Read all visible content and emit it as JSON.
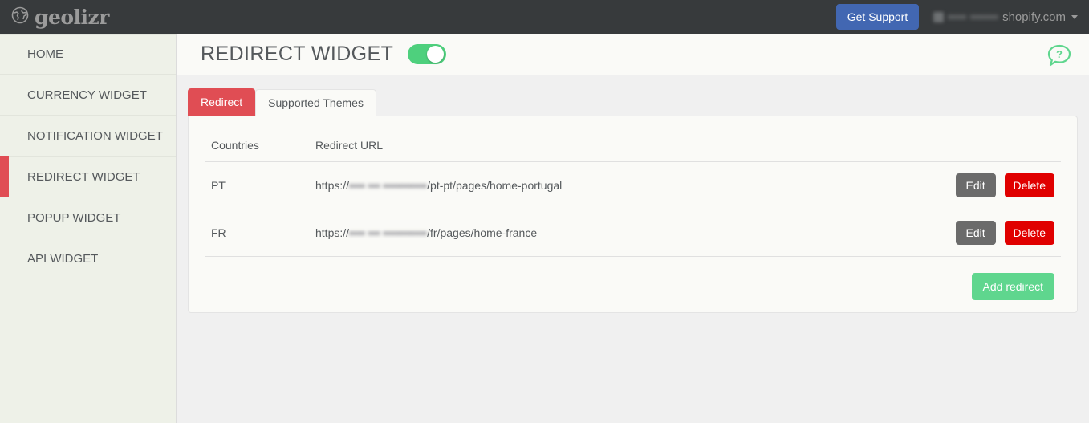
{
  "navbar": {
    "brand_name": "geolizr",
    "brand_icon": "globe-icon",
    "get_support_label": "Get Support",
    "account_redacted_text": "▪▪▪▪ ▪▪▪▪▪▪",
    "account_domain": "shopify.com",
    "caret_icon": "chevron-down-icon"
  },
  "sidebar": {
    "items": [
      {
        "label": "HOME",
        "active": false
      },
      {
        "label": "CURRENCY WIDGET",
        "active": false
      },
      {
        "label": "NOTIFICATION WIDGET",
        "active": false
      },
      {
        "label": "REDIRECT WIDGET",
        "active": true
      },
      {
        "label": "POPUP WIDGET",
        "active": false
      },
      {
        "label": "API WIDGET",
        "active": false
      }
    ]
  },
  "page": {
    "title": "REDIRECT WIDGET",
    "widget_enabled": true,
    "help_icon": "help-question-bubble-icon"
  },
  "tabs": [
    {
      "label": "Redirect",
      "active": true
    },
    {
      "label": "Supported Themes",
      "active": false
    }
  ],
  "table": {
    "headers": {
      "countries": "Countries",
      "redirect_url": "Redirect URL"
    },
    "rows": [
      {
        "country": "PT",
        "url_prefix": "https://",
        "url_redacted": "▪▪▪▪ ▪▪▪ ▪▪▪▪▪▪▪▪▪▪▪",
        "url_suffix": "/pt-pt/pages/home-portugal",
        "edit_label": "Edit",
        "delete_label": "Delete"
      },
      {
        "country": "FR",
        "url_prefix": "https://",
        "url_redacted": "▪▪▪▪ ▪▪▪ ▪▪▪▪▪▪▪▪▪▪▪",
        "url_suffix": "/fr/pages/home-france",
        "edit_label": "Edit",
        "delete_label": "Delete"
      }
    ],
    "add_redirect_label": "Add redirect"
  },
  "colors": {
    "navbar_bg": "#373a3c",
    "sidebar_bg": "#eef1e8",
    "active_accent": "#e04d54",
    "support_blue": "#4267b2",
    "toggle_green": "#4ed07d",
    "add_green": "#5fd68e",
    "delete_red": "#e00000",
    "edit_gray": "#6b6b6b"
  }
}
